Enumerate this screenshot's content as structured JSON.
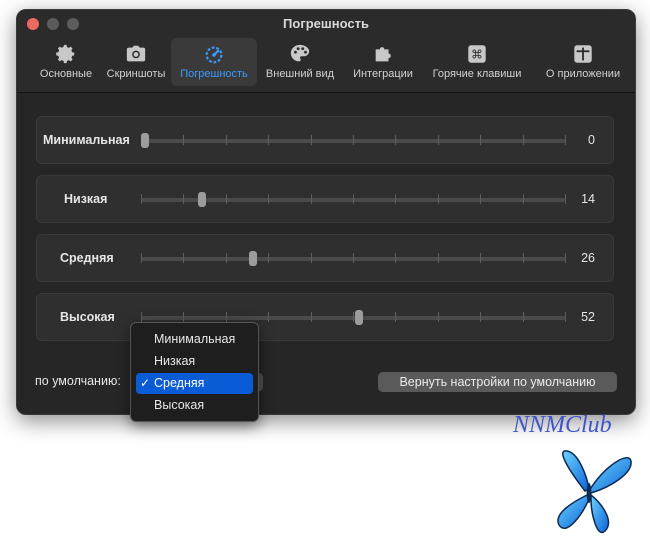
{
  "window": {
    "title": "Погрешность"
  },
  "tabs": [
    {
      "label": "Основные",
      "icon": "gear-icon"
    },
    {
      "label": "Скриншоты",
      "icon": "camera-icon"
    },
    {
      "label": "Погрешность",
      "icon": "accuracy-gauge-icon"
    },
    {
      "label": "Внешний вид",
      "icon": "palette-icon"
    },
    {
      "label": "Интеграции",
      "icon": "puzzle-icon"
    },
    {
      "label": "Горячие клавиши",
      "icon": "command-key-icon"
    },
    {
      "label": "О приложении",
      "icon": "ruler-icon"
    }
  ],
  "active_tab": "Погрешность",
  "levels": [
    {
      "label": "Минимальная",
      "value": "0",
      "slider_fraction": 0.0
    },
    {
      "label": "Низкая",
      "value": "14",
      "slider_fraction": 0.145
    },
    {
      "label": "Средняя",
      "value": "26",
      "slider_fraction": 0.265
    },
    {
      "label": "Высокая",
      "value": "52",
      "slider_fraction": 0.515
    }
  ],
  "default_label": "по умолчанию:",
  "reset_button": "Вернуть настройки по умолчанию",
  "dropdown": {
    "options": [
      "Минимальная",
      "Низкая",
      "Средняя",
      "Высокая"
    ],
    "selected": "Средняя",
    "check": "✓"
  },
  "watermark": "NNMClub",
  "colors": {
    "accent": "#3a9bff",
    "menu_selection": "#0a5bd6",
    "window_bg": "#262626",
    "watermark": "#3f55c8"
  }
}
